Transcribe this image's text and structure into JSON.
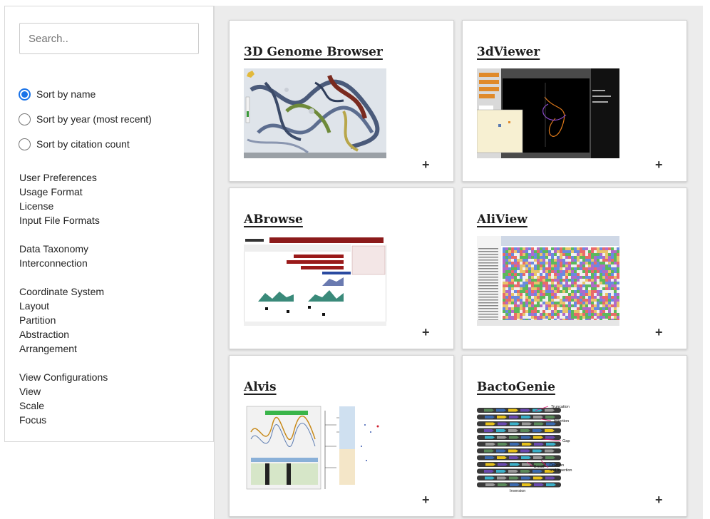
{
  "search": {
    "placeholder": "Search.."
  },
  "sort_options": [
    {
      "label": "Sort by name",
      "checked": true
    },
    {
      "label": "Sort by year (most recent)",
      "checked": false
    },
    {
      "label": "Sort by citation count",
      "checked": false
    }
  ],
  "filter_groups": [
    [
      "User Preferences",
      "Usage Format",
      "License",
      "Input File Formats"
    ],
    [
      "Data Taxonomy",
      "Interconnection"
    ],
    [
      "Coordinate System",
      "Layout",
      "Partition",
      "Abstraction",
      "Arrangement"
    ],
    [
      "View Configurations",
      "View",
      "Scale",
      "Focus"
    ]
  ],
  "tools": [
    {
      "title": "3D Genome Browser",
      "thumb_icon": "3d-genome-structure-image"
    },
    {
      "title": "3dViewer",
      "thumb_icon": "3d-viewer-dark-canvas-image"
    },
    {
      "title": "ABrowse",
      "thumb_icon": "genome-track-browser-image"
    },
    {
      "title": "AliView",
      "thumb_icon": "sequence-alignment-matrix-image"
    },
    {
      "title": "Alvis",
      "thumb_icon": "alignment-visualization-image"
    },
    {
      "title": "BactoGenie",
      "thumb_icon": "gene-arrow-tracks-image"
    }
  ],
  "bactogenie_labels": [
    "Truncation",
    "Insertion",
    "Gap",
    "Break",
    "Deletion",
    "and insertion",
    "Inversion"
  ],
  "card_action_symbol": "+",
  "colors": {
    "radio_checked": "#1a73e8",
    "panel_bg": "#ececec"
  }
}
